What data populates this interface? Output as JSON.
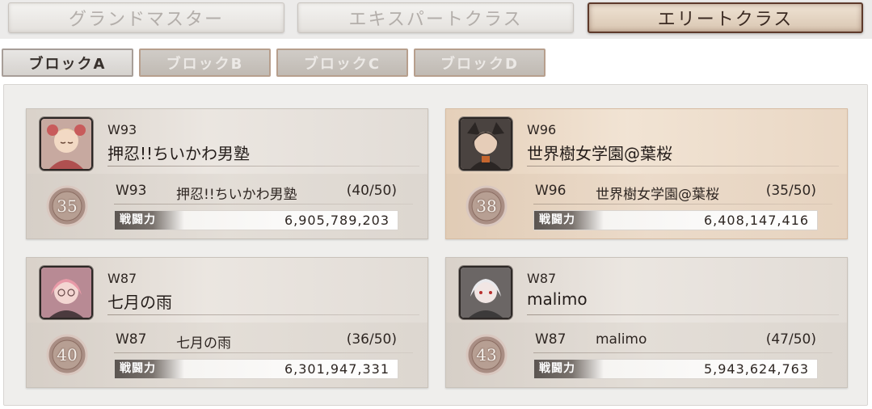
{
  "class_tabs": [
    {
      "label": "グランドマスター",
      "active": false
    },
    {
      "label": "エキスパートクラス",
      "active": false
    },
    {
      "label": "エリートクラス",
      "active": true
    }
  ],
  "block_tabs": [
    {
      "label": "ブロックA",
      "active": true
    },
    {
      "label": "ブロックB",
      "active": false
    },
    {
      "label": "ブロックC",
      "active": false
    },
    {
      "label": "ブロックD",
      "active": false
    }
  ],
  "power_label": "戦闘力",
  "colors": {
    "active_tab_border": "#5e3a2b",
    "card_default": "#e2ddd7",
    "card_highlight": "#ead9c6",
    "rank_seal": "#b79f93"
  },
  "cards": [
    {
      "world": "W93",
      "guild": "押忍!!ちいかわ男塾",
      "rank": "35",
      "count": "(40/50)",
      "power": "6,905,789,203",
      "highlight": false
    },
    {
      "world": "W96",
      "guild": "世界樹女学園@葉桜",
      "rank": "38",
      "count": "(35/50)",
      "power": "6,408,147,416",
      "highlight": true
    },
    {
      "world": "W87",
      "guild": "七月の雨",
      "rank": "40",
      "count": "(36/50)",
      "power": "6,301,947,331",
      "highlight": false
    },
    {
      "world": "W87",
      "guild": "malimo",
      "rank": "43",
      "count": "(47/50)",
      "power": "5,943,624,763",
      "highlight": false
    }
  ]
}
